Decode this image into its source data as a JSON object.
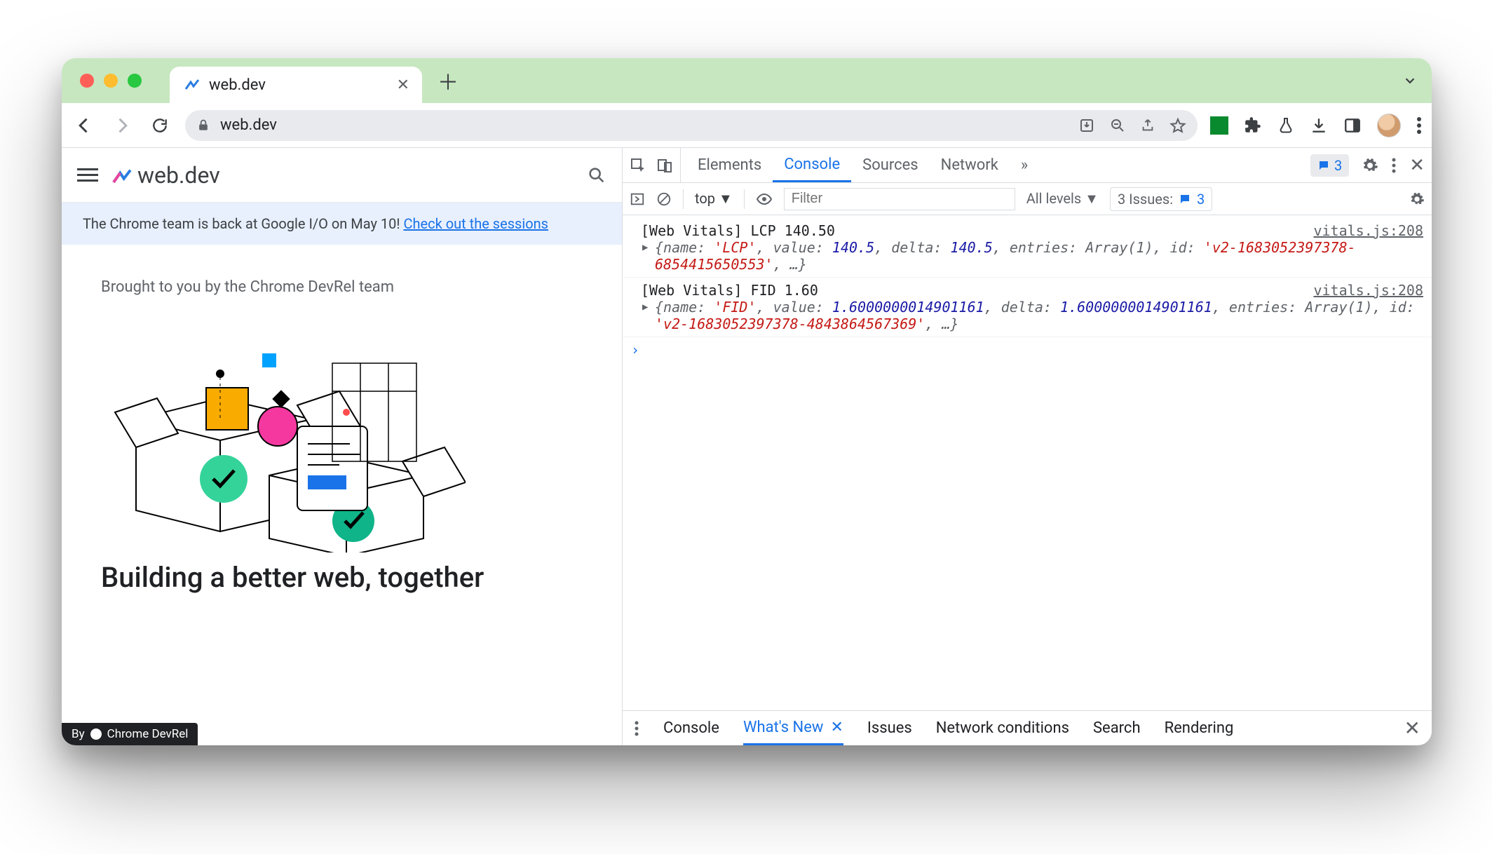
{
  "chrome": {
    "tab_title": "web.dev",
    "url": "web.dev"
  },
  "page": {
    "brand": "web.dev",
    "banner_text": "The Chrome team is back at Google I/O on May 10! ",
    "banner_link": "Check out the sessions",
    "subheading": "Brought to you by the Chrome DevRel team",
    "headline": "Building a better web, together",
    "badge": "Chrome DevRel",
    "badge_prefix": "By"
  },
  "devtools": {
    "tabs": [
      "Elements",
      "Console",
      "Sources",
      "Network"
    ],
    "active_tab": "Console",
    "messages_count": "3",
    "filterbar": {
      "context": "top",
      "filter_placeholder": "Filter",
      "levels": "All levels",
      "issues_label": "3 Issues:",
      "issues_count": "3"
    },
    "logs": [
      {
        "head": "[Web Vitals] LCP 140.50",
        "src": "vitals.js:208",
        "obj_html": "{<span class='k'>name:</span> <span class='s'>'LCP'</span>, <span class='k'>value:</span> <span class='n'>140.5</span>, <span class='k'>delta:</span> <span class='n'>140.5</span>, <span class='k'>entries:</span> Array(1), <span class='k'>id:</span> <span class='s'>'v2-1683052397378-6854415650553'</span>, …}"
      },
      {
        "head": "[Web Vitals] FID 1.60",
        "src": "vitals.js:208",
        "obj_html": "{<span class='k'>name:</span> <span class='s'>'FID'</span>, <span class='k'>value:</span> <span class='n'>1.6000000014901161</span>, <span class='k'>delta:</span> <span class='n'>1.6000000014901161</span>, <span class='k'>entries:</span> Array(1), <span class='k'>id:</span> <span class='s'>'v2-1683052397378-4843864567369'</span>, …}"
      }
    ],
    "drawer": {
      "tabs": [
        "Console",
        "What's New",
        "Issues",
        "Network conditions",
        "Search",
        "Rendering"
      ],
      "active": "What's New"
    }
  }
}
